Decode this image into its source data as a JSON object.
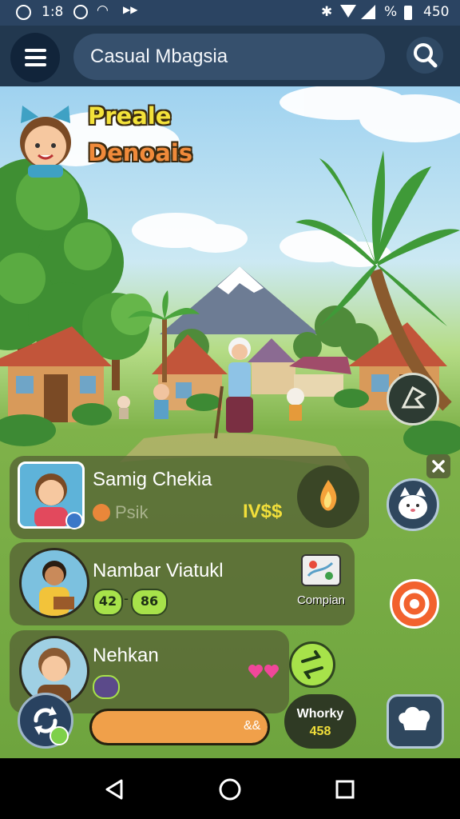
{
  "status_bar": {
    "time": "1:8",
    "wifi_level": "%",
    "battery": "450",
    "icons": [
      "alarm-icon",
      "wifi-icon",
      "notification-icon",
      "bluetooth-icon",
      "signal-icon",
      "battery-icon"
    ]
  },
  "topbar": {
    "search_value": "Casual Mbagsia",
    "icons": [
      "menu-icon",
      "search-icon"
    ]
  },
  "scene": {
    "title_line1": "Preale",
    "title_line2": "Denoais"
  },
  "players": [
    {
      "name": "Samig Chekia",
      "tag": "Psik",
      "score": "IV$$",
      "action_icon": "flame-icon"
    },
    {
      "name": "Nambar Viatukl",
      "stats": [
        "42",
        "86"
      ],
      "action_label": "Compian",
      "action_icon": "map-icon"
    },
    {
      "name": "Nehkan",
      "reaction_icon": "hearts-icon",
      "action_icon": "swap-icon"
    }
  ],
  "side_buttons": [
    "close-icon",
    "cat-icon",
    "target-icon"
  ],
  "bottom": {
    "progress_label": "&&",
    "progress_fraction": 1.0,
    "wallet_title": "Whorky",
    "wallet_value": "458"
  },
  "colors": {
    "accent_orange": "#f0a04a",
    "accent_green": "#a7e24a",
    "bar_blue": "#22384f"
  }
}
